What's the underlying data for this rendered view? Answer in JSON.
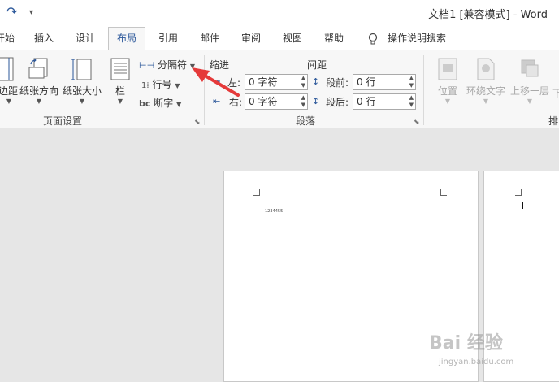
{
  "titlebar": {
    "redo_glyph": "↷",
    "customize_glyph": "▾",
    "doc_title": "文档1 [兼容模式] - Word"
  },
  "tabs": [
    "开始",
    "插入",
    "设计",
    "布局",
    "引用",
    "邮件",
    "审阅",
    "视图",
    "帮助"
  ],
  "tell_me": "操作说明搜索",
  "page_setup": {
    "margins": "边距",
    "orientation": "纸张方向",
    "size": "纸张大小",
    "columns": "栏",
    "breaks": "分隔符",
    "line_numbers": "行号",
    "hyphenation": "断字",
    "hyphen_icon": "bc",
    "group_label": "页面设置"
  },
  "paragraph": {
    "indent_header": "缩进",
    "spacing_header": "间距",
    "left_label": "左:",
    "right_label": "右:",
    "left_value": "0 字符",
    "right_value": "0 字符",
    "before_label": "段前:",
    "after_label": "段后:",
    "before_value": "0 行",
    "after_value": "0 行",
    "group_label": "段落"
  },
  "arrange": {
    "position": "位置",
    "wrap_text": "环绕文字",
    "bring_forward": "上移一层",
    "send_backward": "下",
    "group_label": "排列"
  },
  "document": {
    "page1_text": "1234455"
  },
  "watermark": {
    "main": "Bai 经验",
    "sub": "jingyan.baidu.com"
  },
  "colors": {
    "accent": "#2b579a",
    "arrow": "#e53a3a"
  }
}
